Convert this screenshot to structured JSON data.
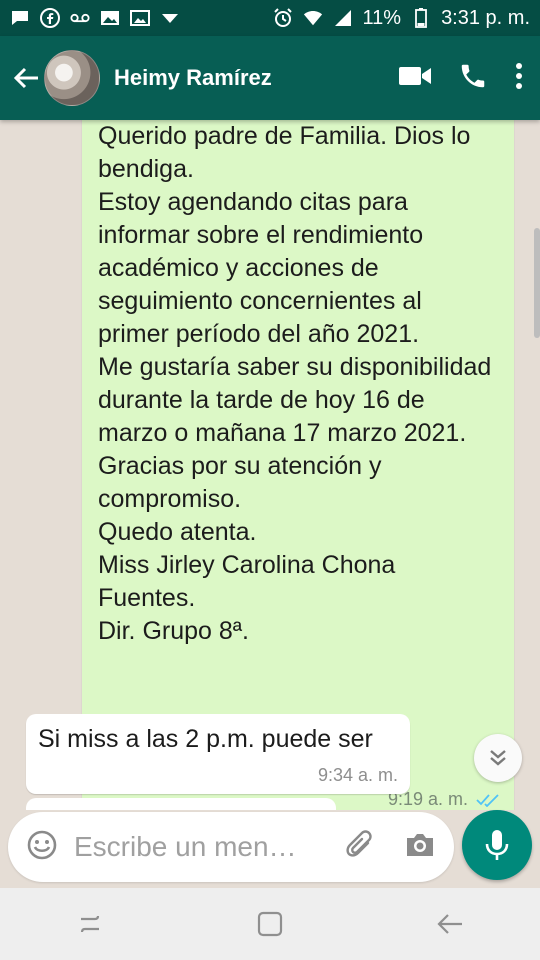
{
  "status_bar": {
    "battery": "11%",
    "time": "3:31 p. m.",
    "left_icons": [
      "message-icon",
      "facebook-icon",
      "voicemail-icon",
      "image-icon",
      "photo-icon",
      "dropdown-icon"
    ],
    "right_icons": [
      "alarm-icon",
      "wifi-icon",
      "signal-icon",
      "battery-icon"
    ]
  },
  "header": {
    "contact_name": "Heimy Ramírez",
    "icons": [
      "back-arrow-icon",
      "video-call-icon",
      "phone-icon",
      "more-options-icon"
    ]
  },
  "messages": [
    {
      "direction": "outgoing",
      "text": "Querido padre de Familia. Dios lo bendiga.\nEstoy agendando citas para informar sobre el rendimiento académico y acciones de seguimiento concernientes al primer período del año 2021.\nMe gustaría saber su disponibilidad durante la tarde de hoy 16 de marzo o mañana 17 marzo 2021.\nGracias por su atención y compromiso.\nQuedo atenta.\nMiss Jirley Carolina Chona Fuentes.\nDir. Grupo 8ª.",
      "time": "9:19 a. m.",
      "status": "read"
    },
    {
      "direction": "incoming",
      "text": "Si miss a las 2 p.m. puede ser",
      "time": "9:34 a. m."
    }
  ],
  "composer": {
    "placeholder": "Escribe un men…",
    "value": ""
  },
  "colors": {
    "status_bar": "#054d44",
    "header": "#075e54",
    "outgoing_bubble": "#dcf8c6",
    "incoming_bubble": "#ffffff",
    "chat_background": "#e5ddd5",
    "mic_button": "#00897b",
    "read_ticks": "#4fc3f7"
  }
}
